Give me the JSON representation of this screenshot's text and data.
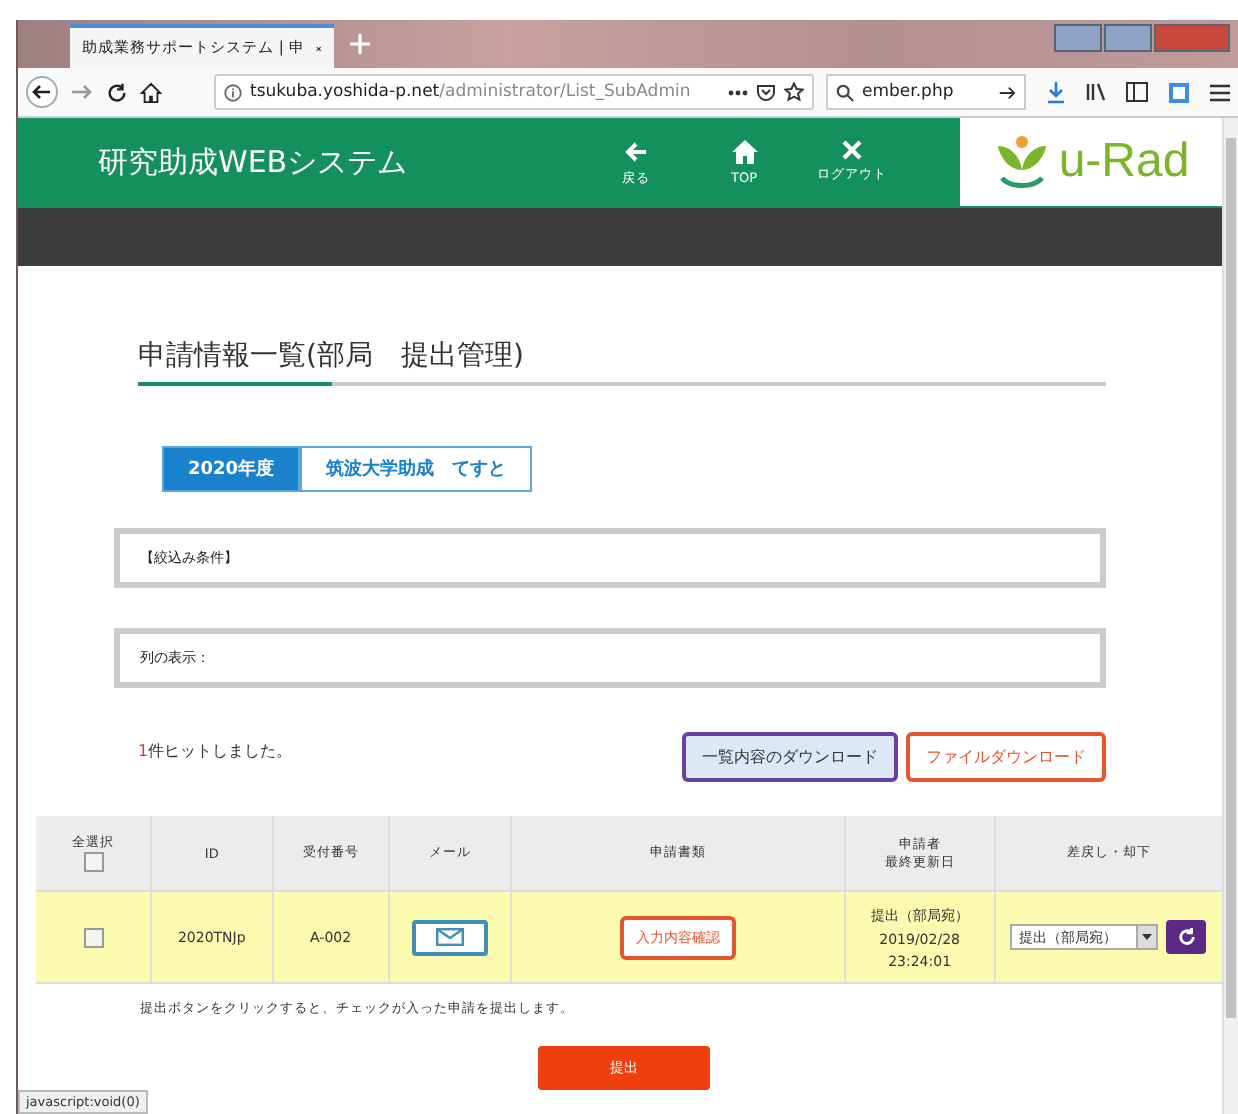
{
  "browser": {
    "tab_title": "助成業務サポートシステム | 申",
    "url_host": "tsukuba.yoshida-p.net",
    "url_path": "/administrator/List_SubAdmin",
    "search_text": "ember.php"
  },
  "header": {
    "title": "研究助成WEBシステム",
    "nav": [
      {
        "kind": "back",
        "label": "戻る"
      },
      {
        "kind": "home",
        "label": "TOP"
      },
      {
        "kind": "close",
        "label": "ログアウト"
      }
    ],
    "logo": "u-Rad"
  },
  "page_title": "申請情報一覧(部局　提出管理)",
  "tabs": [
    {
      "label": "2020年度",
      "selected": true
    },
    {
      "label": "筑波大学助成　てすと",
      "selected": false
    }
  ],
  "filter_label": "【絞込み条件】",
  "columns_label": "列の表示：",
  "hit_count": "1",
  "hit_text": "件ヒットしました。",
  "buttons": [
    {
      "kind": "purple",
      "label": "一覧内容のダウンロード"
    },
    {
      "kind": "orange",
      "label": "ファイルダウンロード"
    }
  ],
  "table": {
    "select_all": {
      "label": "全選択",
      "checked": false
    },
    "columns": [
      [
        "ID"
      ],
      [
        "受付番号"
      ],
      [
        "メール"
      ],
      [
        "申請書類"
      ],
      [
        "申請者",
        "最終更新日"
      ],
      [
        "差戻し・却下"
      ]
    ],
    "rows": [
      {
        "checked": false,
        "id": "2020TNJp",
        "number": "A-002",
        "docs_button": "入力内容確認",
        "status": "提出（部局宛）",
        "date": "2019/02/28",
        "time": "23:24:01",
        "select_value": "提出（部局宛）"
      }
    ]
  },
  "note": "提出ボタンをクリックすると、チェックが入った申請を提出します。",
  "submit": "提出",
  "status_bar": "javascript:void(0)"
}
